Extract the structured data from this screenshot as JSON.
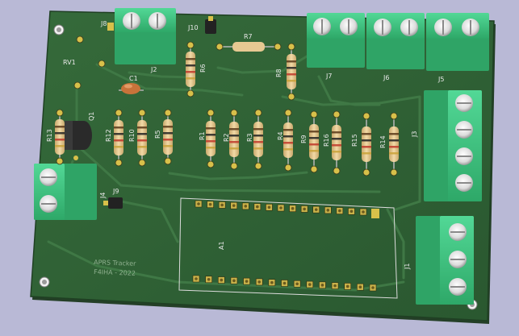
{
  "colors": {
    "background": "#b9b9d6",
    "board": "#2f5e34",
    "board_edge": "#254a2a",
    "trace": "#3b7240",
    "silkscreen": "#e8e8e8",
    "terminal_green": "#3fbf80",
    "resistor_body": "#e7c992",
    "pad_gold": "#d7c04a",
    "capacitor": "#c8733a",
    "transistor": "#2a2a2a"
  },
  "designators": {
    "J8": "J8",
    "J10": "J10",
    "R7": "R7",
    "J2": "J2",
    "RV1": "RV1",
    "C1": "C1",
    "R6": "R6",
    "R8": "R8",
    "J7": "J7",
    "J6": "J6",
    "J5": "J5",
    "Q1": "Q1",
    "R13": "R13",
    "R12": "R12",
    "R10": "R10",
    "R5": "R5",
    "R1": "R1",
    "R2": "R2",
    "R3": "R3",
    "R4": "R4",
    "R9": "R9",
    "R16": "R16",
    "R15": "R15",
    "R14": "R14",
    "J3": "J3",
    "J4": "J4",
    "J9": "J9",
    "A1": "A1",
    "J1": "J1"
  },
  "board_text": {
    "line1": "APRS Tracker",
    "line2": "F4IHA - 2022"
  }
}
